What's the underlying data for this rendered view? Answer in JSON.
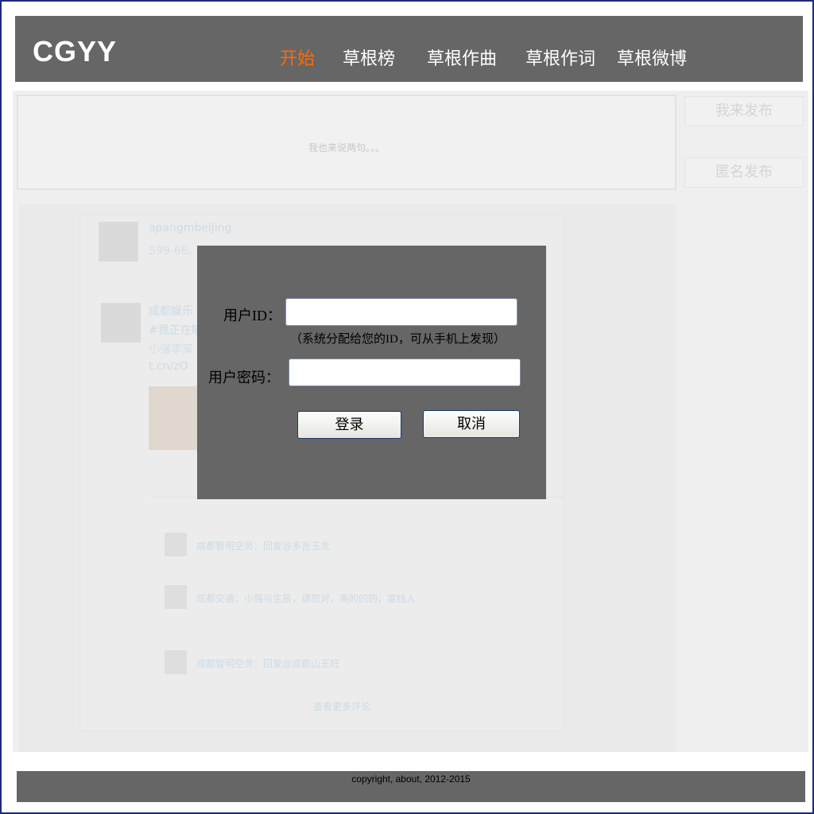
{
  "header": {
    "logo": "CGYY",
    "nav": [
      {
        "label": "开始",
        "active": true
      },
      {
        "label": "草根榜"
      },
      {
        "label": "草根作曲"
      },
      {
        "label": "草根作词"
      },
      {
        "label": "草根微博"
      }
    ]
  },
  "composer": {
    "placeholder": "我也来说两句。。。",
    "publish_label": "我来发布",
    "anonymous_label": "匿名发布"
  },
  "feed": {
    "posts": [
      {
        "user": "apangmbeijing",
        "text": "599-66。"
      },
      {
        "user": "成都娱乐",
        "text": "#我正在听",
        "text2": "小强李家",
        "link": "t.cn/zO"
      }
    ],
    "comments": [
      {
        "text": "成都智明空务：回复@多吉玉龙"
      },
      {
        "text": "成都交通：小强与生辰，请您对，美的的的，度线人"
      },
      {
        "text": "成都智明空务：回复@成都山王旺"
      }
    ],
    "more_link": "查看更多评论"
  },
  "login": {
    "user_id_label": "用户ID：",
    "user_id_value": "",
    "note": "（系统分配给您的ID，可从手机上发现）",
    "password_label": "用户密码：",
    "password_value": "",
    "login_button": "登录",
    "cancel_button": "取消"
  },
  "footer": {
    "copyright": "copyright, about, 2012-2015"
  },
  "colors": {
    "header_bg": "#666666",
    "nav_active": "#ff6a00",
    "dialog_bg": "#666666",
    "border": "#1d2b7a"
  }
}
